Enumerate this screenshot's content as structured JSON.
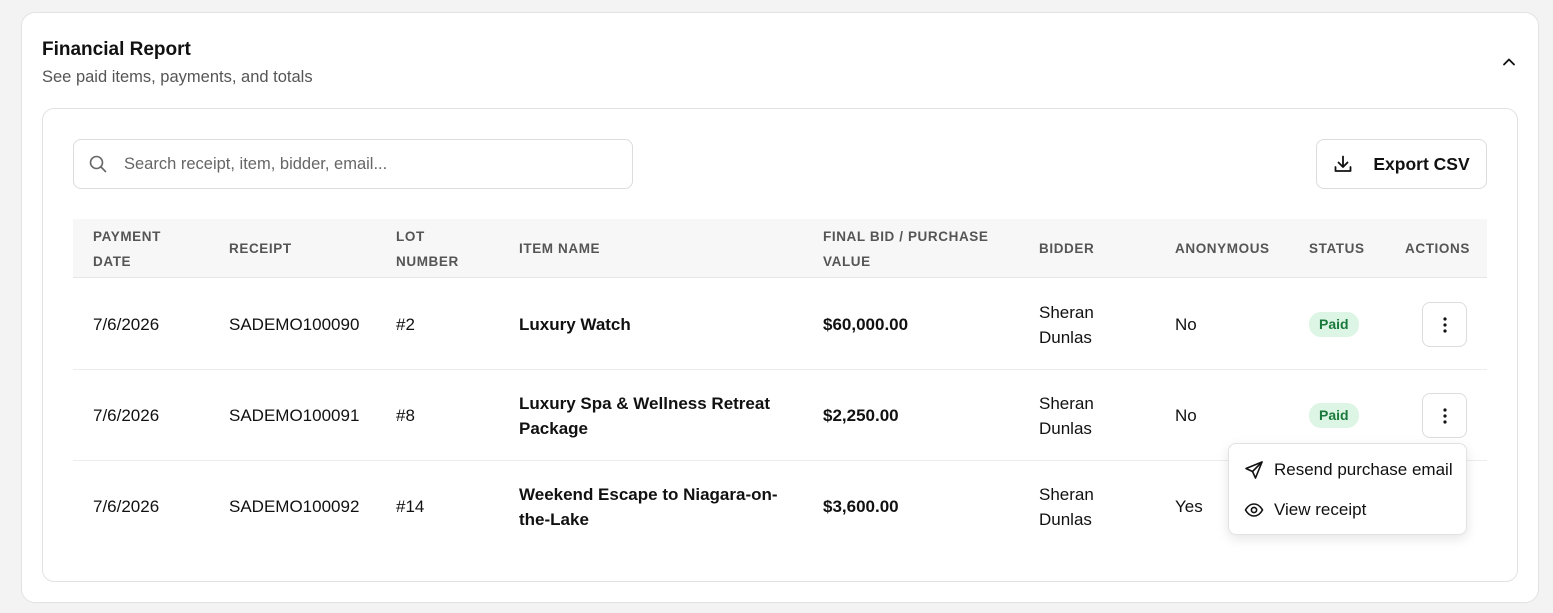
{
  "header": {
    "title": "Financial Report",
    "subtitle": "See paid items, payments, and totals"
  },
  "toolbar": {
    "search_placeholder": "Search receipt, item, bidder, email...",
    "export_label": "Export CSV"
  },
  "columns": {
    "payment_date": [
      "PAYMENT",
      "DATE"
    ],
    "receipt": "RECEIPT",
    "lot_number": [
      "LOT",
      "NUMBER"
    ],
    "item_name": "ITEM NAME",
    "final_bid": [
      "FINAL BID / PURCHASE",
      "VALUE"
    ],
    "bidder": "BIDDER",
    "anonymous": "ANONYMOUS",
    "status": "STATUS",
    "actions": "ACTIONS"
  },
  "rows": [
    {
      "payment_date": "7/6/2026",
      "receipt": "SADEMO100090",
      "lot": "#2",
      "item": [
        "Luxury Watch"
      ],
      "amount": "$60,000.00",
      "bidder": [
        "Sheran",
        "Dunlas"
      ],
      "anonymous": "No",
      "status": "Paid"
    },
    {
      "payment_date": "7/6/2026",
      "receipt": "SADEMO100091",
      "lot": "#8",
      "item": [
        "Luxury Spa & Wellness Retreat",
        "Package"
      ],
      "amount": "$2,250.00",
      "bidder": [
        "Sheran",
        "Dunlas"
      ],
      "anonymous": "No",
      "status": "Paid"
    },
    {
      "payment_date": "7/6/2026",
      "receipt": "SADEMO100092",
      "lot": "#14",
      "item": [
        "Weekend Escape to Niagara-on-",
        "the-Lake"
      ],
      "amount": "$3,600.00",
      "bidder": [
        "Sheran",
        "Dunlas"
      ],
      "anonymous": "Yes",
      "status": ""
    }
  ],
  "menu": {
    "resend": "Resend purchase email",
    "view": "View receipt"
  },
  "icons": {
    "collapse": "chevron-up-icon",
    "search": "search-icon",
    "export": "download-icon",
    "actions": "more-vertical-icon",
    "resend": "send-icon",
    "view": "eye-icon"
  },
  "colors": {
    "paid_badge_bg": "#dcf5e4",
    "paid_badge_text": "#1a7a3c"
  }
}
